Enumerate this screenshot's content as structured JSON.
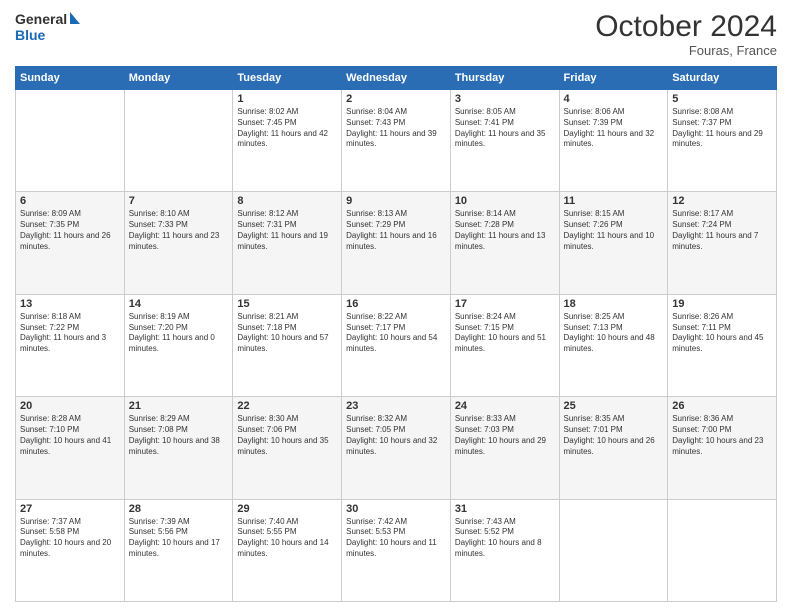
{
  "header": {
    "logo_line1": "General",
    "logo_line2": "Blue",
    "month": "October 2024",
    "location": "Fouras, France"
  },
  "days_of_week": [
    "Sunday",
    "Monday",
    "Tuesday",
    "Wednesday",
    "Thursday",
    "Friday",
    "Saturday"
  ],
  "weeks": [
    [
      {
        "day": "",
        "sunrise": "",
        "sunset": "",
        "daylight": ""
      },
      {
        "day": "",
        "sunrise": "",
        "sunset": "",
        "daylight": ""
      },
      {
        "day": "1",
        "sunrise": "Sunrise: 8:02 AM",
        "sunset": "Sunset: 7:45 PM",
        "daylight": "Daylight: 11 hours and 42 minutes."
      },
      {
        "day": "2",
        "sunrise": "Sunrise: 8:04 AM",
        "sunset": "Sunset: 7:43 PM",
        "daylight": "Daylight: 11 hours and 39 minutes."
      },
      {
        "day": "3",
        "sunrise": "Sunrise: 8:05 AM",
        "sunset": "Sunset: 7:41 PM",
        "daylight": "Daylight: 11 hours and 35 minutes."
      },
      {
        "day": "4",
        "sunrise": "Sunrise: 8:06 AM",
        "sunset": "Sunset: 7:39 PM",
        "daylight": "Daylight: 11 hours and 32 minutes."
      },
      {
        "day": "5",
        "sunrise": "Sunrise: 8:08 AM",
        "sunset": "Sunset: 7:37 PM",
        "daylight": "Daylight: 11 hours and 29 minutes."
      }
    ],
    [
      {
        "day": "6",
        "sunrise": "Sunrise: 8:09 AM",
        "sunset": "Sunset: 7:35 PM",
        "daylight": "Daylight: 11 hours and 26 minutes."
      },
      {
        "day": "7",
        "sunrise": "Sunrise: 8:10 AM",
        "sunset": "Sunset: 7:33 PM",
        "daylight": "Daylight: 11 hours and 23 minutes."
      },
      {
        "day": "8",
        "sunrise": "Sunrise: 8:12 AM",
        "sunset": "Sunset: 7:31 PM",
        "daylight": "Daylight: 11 hours and 19 minutes."
      },
      {
        "day": "9",
        "sunrise": "Sunrise: 8:13 AM",
        "sunset": "Sunset: 7:29 PM",
        "daylight": "Daylight: 11 hours and 16 minutes."
      },
      {
        "day": "10",
        "sunrise": "Sunrise: 8:14 AM",
        "sunset": "Sunset: 7:28 PM",
        "daylight": "Daylight: 11 hours and 13 minutes."
      },
      {
        "day": "11",
        "sunrise": "Sunrise: 8:15 AM",
        "sunset": "Sunset: 7:26 PM",
        "daylight": "Daylight: 11 hours and 10 minutes."
      },
      {
        "day": "12",
        "sunrise": "Sunrise: 8:17 AM",
        "sunset": "Sunset: 7:24 PM",
        "daylight": "Daylight: 11 hours and 7 minutes."
      }
    ],
    [
      {
        "day": "13",
        "sunrise": "Sunrise: 8:18 AM",
        "sunset": "Sunset: 7:22 PM",
        "daylight": "Daylight: 11 hours and 3 minutes."
      },
      {
        "day": "14",
        "sunrise": "Sunrise: 8:19 AM",
        "sunset": "Sunset: 7:20 PM",
        "daylight": "Daylight: 11 hours and 0 minutes."
      },
      {
        "day": "15",
        "sunrise": "Sunrise: 8:21 AM",
        "sunset": "Sunset: 7:18 PM",
        "daylight": "Daylight: 10 hours and 57 minutes."
      },
      {
        "day": "16",
        "sunrise": "Sunrise: 8:22 AM",
        "sunset": "Sunset: 7:17 PM",
        "daylight": "Daylight: 10 hours and 54 minutes."
      },
      {
        "day": "17",
        "sunrise": "Sunrise: 8:24 AM",
        "sunset": "Sunset: 7:15 PM",
        "daylight": "Daylight: 10 hours and 51 minutes."
      },
      {
        "day": "18",
        "sunrise": "Sunrise: 8:25 AM",
        "sunset": "Sunset: 7:13 PM",
        "daylight": "Daylight: 10 hours and 48 minutes."
      },
      {
        "day": "19",
        "sunrise": "Sunrise: 8:26 AM",
        "sunset": "Sunset: 7:11 PM",
        "daylight": "Daylight: 10 hours and 45 minutes."
      }
    ],
    [
      {
        "day": "20",
        "sunrise": "Sunrise: 8:28 AM",
        "sunset": "Sunset: 7:10 PM",
        "daylight": "Daylight: 10 hours and 41 minutes."
      },
      {
        "day": "21",
        "sunrise": "Sunrise: 8:29 AM",
        "sunset": "Sunset: 7:08 PM",
        "daylight": "Daylight: 10 hours and 38 minutes."
      },
      {
        "day": "22",
        "sunrise": "Sunrise: 8:30 AM",
        "sunset": "Sunset: 7:06 PM",
        "daylight": "Daylight: 10 hours and 35 minutes."
      },
      {
        "day": "23",
        "sunrise": "Sunrise: 8:32 AM",
        "sunset": "Sunset: 7:05 PM",
        "daylight": "Daylight: 10 hours and 32 minutes."
      },
      {
        "day": "24",
        "sunrise": "Sunrise: 8:33 AM",
        "sunset": "Sunset: 7:03 PM",
        "daylight": "Daylight: 10 hours and 29 minutes."
      },
      {
        "day": "25",
        "sunrise": "Sunrise: 8:35 AM",
        "sunset": "Sunset: 7:01 PM",
        "daylight": "Daylight: 10 hours and 26 minutes."
      },
      {
        "day": "26",
        "sunrise": "Sunrise: 8:36 AM",
        "sunset": "Sunset: 7:00 PM",
        "daylight": "Daylight: 10 hours and 23 minutes."
      }
    ],
    [
      {
        "day": "27",
        "sunrise": "Sunrise: 7:37 AM",
        "sunset": "Sunset: 5:58 PM",
        "daylight": "Daylight: 10 hours and 20 minutes."
      },
      {
        "day": "28",
        "sunrise": "Sunrise: 7:39 AM",
        "sunset": "Sunset: 5:56 PM",
        "daylight": "Daylight: 10 hours and 17 minutes."
      },
      {
        "day": "29",
        "sunrise": "Sunrise: 7:40 AM",
        "sunset": "Sunset: 5:55 PM",
        "daylight": "Daylight: 10 hours and 14 minutes."
      },
      {
        "day": "30",
        "sunrise": "Sunrise: 7:42 AM",
        "sunset": "Sunset: 5:53 PM",
        "daylight": "Daylight: 10 hours and 11 minutes."
      },
      {
        "day": "31",
        "sunrise": "Sunrise: 7:43 AM",
        "sunset": "Sunset: 5:52 PM",
        "daylight": "Daylight: 10 hours and 8 minutes."
      },
      {
        "day": "",
        "sunrise": "",
        "sunset": "",
        "daylight": ""
      },
      {
        "day": "",
        "sunrise": "",
        "sunset": "",
        "daylight": ""
      }
    ]
  ]
}
